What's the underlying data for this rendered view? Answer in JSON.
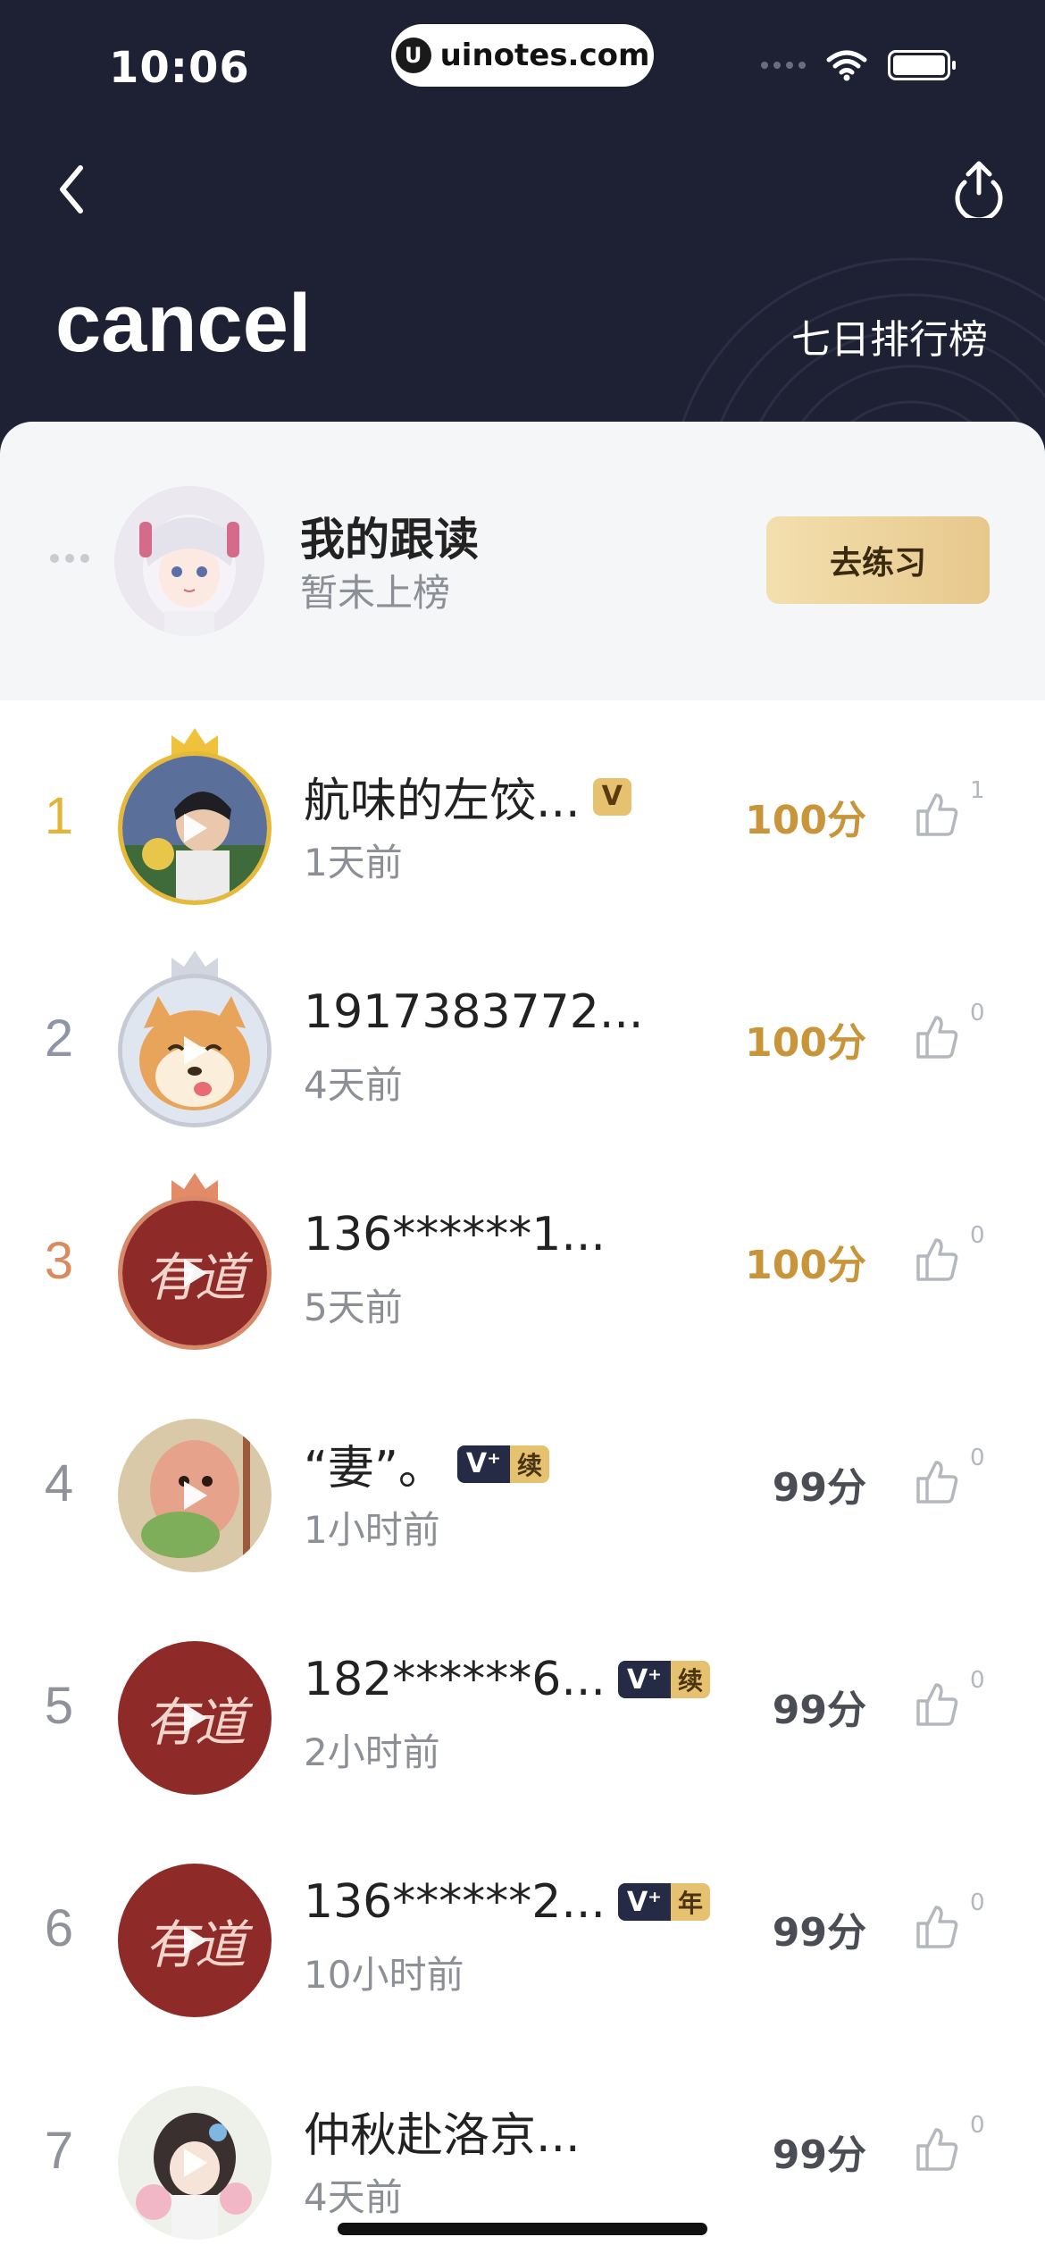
{
  "status_bar": {
    "time": "10:06",
    "url": "uinotes.com"
  },
  "header": {
    "title": "cancel",
    "rank_tab": "七日排行榜"
  },
  "my_card": {
    "name": "我的跟读",
    "status": "暂未上榜",
    "practice_label": "去练习"
  },
  "ranking": [
    {
      "rank": "1",
      "name": "航味的左饺...",
      "time": "1天前",
      "score": "100分",
      "likes": "1",
      "badge": "V"
    },
    {
      "rank": "2",
      "name": "1917383772...",
      "time": "4天前",
      "score": "100分",
      "likes": "0",
      "badge": ""
    },
    {
      "rank": "3",
      "name": "136******1...",
      "time": "5天前",
      "score": "100分",
      "likes": "0",
      "badge": ""
    },
    {
      "rank": "4",
      "name": "“妻”。",
      "time": "1小时前",
      "score": "99分",
      "likes": "0",
      "badge": "V+ 续"
    },
    {
      "rank": "5",
      "name": "182******6...",
      "time": "2小时前",
      "score": "99分",
      "likes": "0",
      "badge": "V+ 续"
    },
    {
      "rank": "6",
      "name": "136******2...",
      "time": "10小时前",
      "score": "99分",
      "likes": "0",
      "badge": "V+ 年"
    },
    {
      "rank": "7",
      "name": "仲秋赴洛京...",
      "time": "4天前",
      "score": "99分",
      "likes": "0",
      "badge": ""
    }
  ],
  "badges": {
    "v": "V",
    "vplus": "V⁺",
    "xu": "续",
    "nian": "年"
  },
  "avatar_text": "有道",
  "colors": {
    "header_bg": "#1e2033",
    "gold": "#c8953a",
    "rank_gold": "#e0b53a",
    "rank_bronze": "#d88b5e"
  }
}
